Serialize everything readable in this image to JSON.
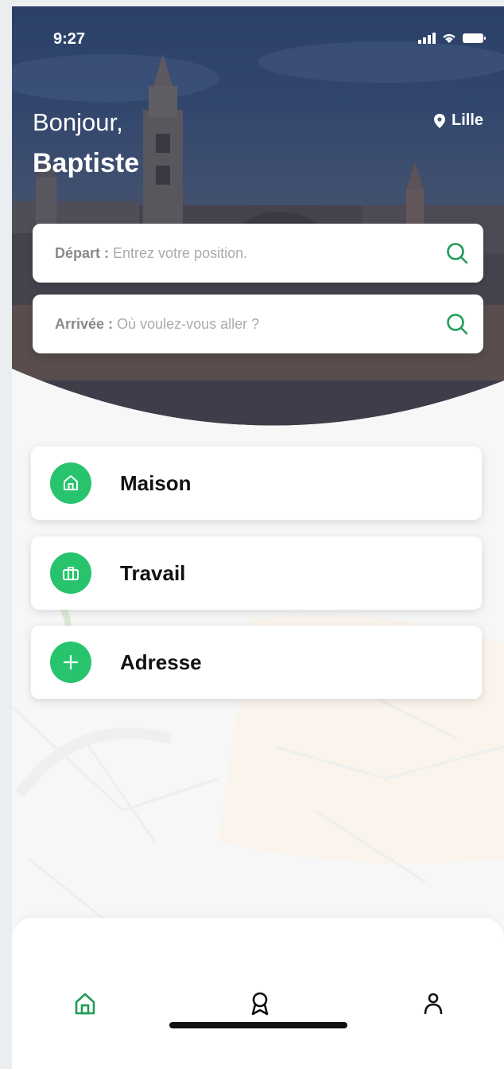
{
  "status": {
    "time": "9:27"
  },
  "header": {
    "greeting": "Bonjour,",
    "user_name": "Baptiste",
    "city": "Lille"
  },
  "search": {
    "departure": {
      "label": "Départ :",
      "placeholder": "Entrez votre position."
    },
    "arrival": {
      "label": "Arrivée :",
      "placeholder": "Où voulez-vous aller ?"
    }
  },
  "shortcuts": [
    {
      "label": "Maison",
      "icon": "home-icon"
    },
    {
      "label": "Travail",
      "icon": "briefcase-icon"
    },
    {
      "label": "Adresse",
      "icon": "plus-icon"
    }
  ],
  "tabbar": {
    "tabs": [
      {
        "icon": "home-icon",
        "active": true
      },
      {
        "icon": "award-icon",
        "active": false
      },
      {
        "icon": "user-icon",
        "active": false
      }
    ]
  },
  "colors": {
    "accent": "#27c46d",
    "accent_dark": "#1f9d57",
    "text": "#111111"
  }
}
